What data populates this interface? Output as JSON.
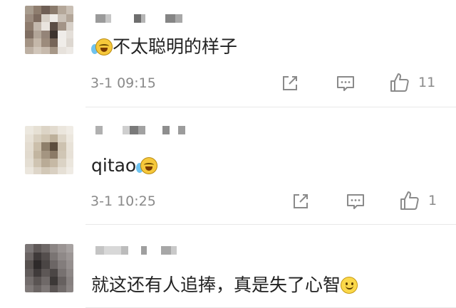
{
  "comments": [
    {
      "content_prefix_emojis": [
        "tear",
        "laugh"
      ],
      "text": "不太聪明的样子",
      "time": "3-1 09:15",
      "like_count": "11"
    },
    {
      "text": "qitao",
      "content_suffix_emojis": [
        "tear",
        "laugh"
      ],
      "time": "3-1 10:25",
      "like_count": "1"
    },
    {
      "text": "就这还有人追捧，真是失了心智",
      "content_suffix_emojis": [
        "smile"
      ]
    }
  ],
  "icons": {
    "share": "share-icon",
    "comment": "comment-icon",
    "like": "like-icon"
  },
  "colors": {
    "text": "#222222",
    "meta": "#8a8a8a",
    "divider": "#e8e8e8"
  }
}
